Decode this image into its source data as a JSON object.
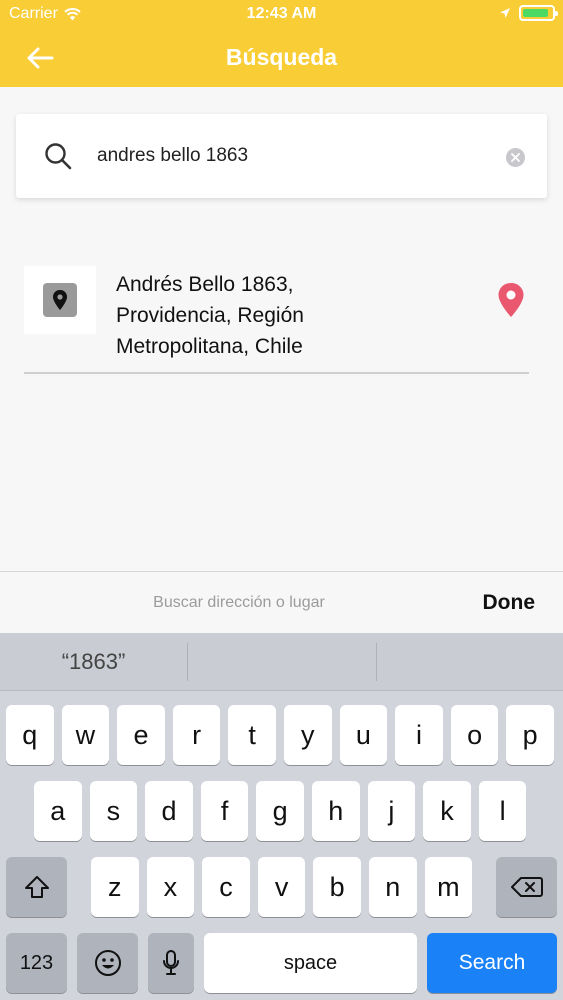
{
  "status_bar": {
    "carrier": "Carrier",
    "time": "12:43 AM",
    "battery_level": 0.9
  },
  "nav": {
    "title": "Búsqueda",
    "back_icon": "arrow-left-icon"
  },
  "search": {
    "value": "andres bello 1863",
    "icon": "search-icon",
    "clear_icon": "clear-icon"
  },
  "results": [
    {
      "address_lines": [
        "Andrés Bello 1863,",
        "Providencia, Región",
        "Metropolitana, Chile"
      ],
      "thumb_icon": "location-pin-icon",
      "action_icon": "map-pin-icon"
    }
  ],
  "accessory": {
    "placeholder": "Buscar dirección o lugar",
    "done_label": "Done"
  },
  "keyboard": {
    "suggestion": "“1863”",
    "row1": [
      "q",
      "w",
      "e",
      "r",
      "t",
      "y",
      "u",
      "i",
      "o",
      "p"
    ],
    "row2": [
      "a",
      "s",
      "d",
      "f",
      "g",
      "h",
      "j",
      "k",
      "l"
    ],
    "row3": [
      "z",
      "x",
      "c",
      "v",
      "b",
      "n",
      "m"
    ],
    "numbers_label": "123",
    "space_label": "space",
    "search_label": "Search"
  },
  "colors": {
    "header": "#f9cd35",
    "pin": "#e9586f",
    "search_key": "#1a82f6"
  }
}
